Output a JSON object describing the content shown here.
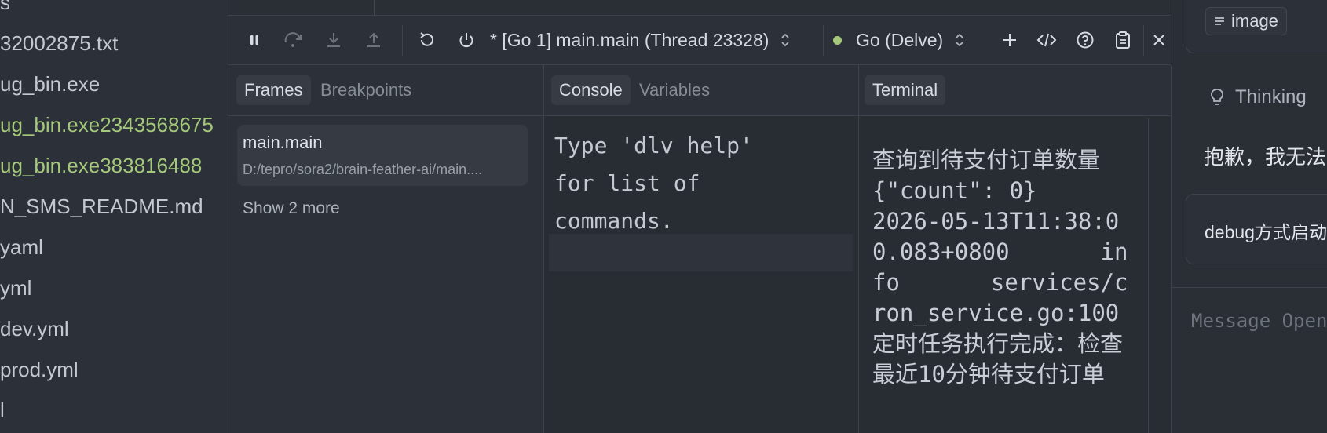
{
  "file_tree": {
    "items": [
      {
        "label": "s",
        "modified": false
      },
      {
        "label": "32002875.txt",
        "modified": false
      },
      {
        "label": "ug_bin.exe",
        "modified": false
      },
      {
        "label": "ug_bin.exe2343568675",
        "modified": true
      },
      {
        "label": "ug_bin.exe383816488",
        "modified": true
      },
      {
        "label": "N_SMS_README.md",
        "modified": false
      },
      {
        "label": "yaml",
        "modified": false
      },
      {
        "label": "yml",
        "modified": false
      },
      {
        "label": "dev.yml",
        "modified": false
      },
      {
        "label": "prod.yml",
        "modified": false
      },
      {
        "label": "l",
        "modified": false
      }
    ]
  },
  "debug_toolbar": {
    "thread_selector": "* [Go 1] main.main (Thread 23328)",
    "adapter_selector": "Go (Delve)",
    "adapter_status_color": "#a5c97a",
    "icons": [
      "pause-icon",
      "step-over-icon",
      "step-into-icon",
      "step-out-icon",
      "restart-icon",
      "power-icon",
      "plus-icon",
      "code-icon",
      "help-icon",
      "clipboard-icon",
      "close-icon"
    ]
  },
  "frames_pane": {
    "tabs": [
      "Frames",
      "Breakpoints"
    ],
    "active_tab": "Frames",
    "frame": {
      "name": "main.main",
      "path": "D:/tepro/sora2/brain-feather-ai/main...."
    },
    "show_more": "Show 2 more"
  },
  "console_pane": {
    "tabs": [
      "Console",
      "Variables"
    ],
    "active_tab": "Console",
    "output": "Type 'dlv help'\nfor list of\ncommands."
  },
  "terminal_pane": {
    "tabs": [
      "Terminal"
    ],
    "output": "查询到待支付订单数量　　　　{\"count\": 0}\n2026-05-13T11:38:00.083+0800　　　　info　　　　services/cron_service.go:100\n定时任务执行完成：检查最近10分钟待支付订单"
  },
  "assistant_panel": {
    "image_chip": "image",
    "thinking_label": "Thinking",
    "assistant_message": "抱歉，我无法",
    "user_message": "debug方式启动",
    "composer_placeholder": "Message Open"
  }
}
